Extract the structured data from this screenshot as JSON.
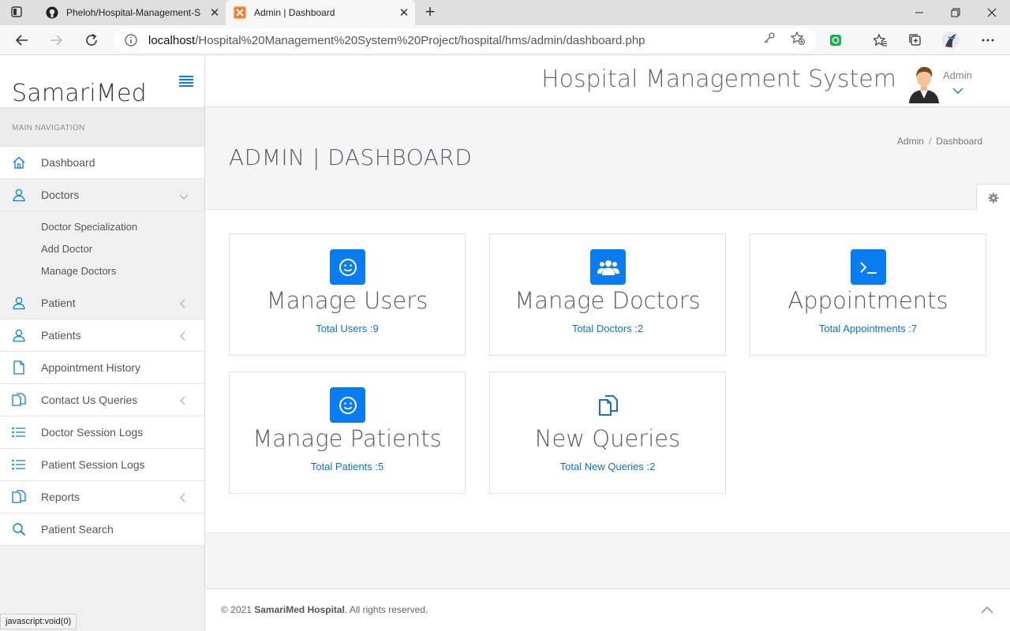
{
  "browser": {
    "tabs": [
      {
        "title": "Pheloh/Hospital-Management-S",
        "active": false,
        "favicon": "github-icon"
      },
      {
        "title": "Admin | Dashboard",
        "active": true,
        "favicon": "xampp-icon"
      }
    ],
    "url_host": "localhost",
    "url_path": "/Hospital%20Management%20System%20Project/hospital/hms/admin/dashboard.php",
    "status_text": "javascript:void(0)"
  },
  "sidebar": {
    "brand": "SamariMed",
    "nav_label": "MAIN NAVIGATION",
    "items": [
      {
        "label": "Dashboard",
        "icon": "home-icon"
      },
      {
        "label": "Doctors",
        "icon": "user-icon",
        "expanded": true,
        "sub": [
          "Doctor Specialization",
          "Add Doctor",
          "Manage Doctors"
        ]
      },
      {
        "label": "Patient",
        "icon": "user-icon"
      },
      {
        "label": "Patients",
        "icon": "user-icon"
      },
      {
        "label": "Appointment History",
        "icon": "file-icon"
      },
      {
        "label": "Contact Us Queries",
        "icon": "files-icon"
      },
      {
        "label": "Doctor Session Logs",
        "icon": "list-icon"
      },
      {
        "label": "Patient Session Logs",
        "icon": "list-icon"
      },
      {
        "label": "Reports",
        "icon": "files-icon"
      },
      {
        "label": "Patient Search",
        "icon": "search-icon"
      }
    ]
  },
  "header": {
    "title": "Hospital Management System",
    "user": "Admin"
  },
  "page": {
    "title": "ADMIN | DASHBOARD",
    "breadcrumb": [
      "Admin",
      "Dashboard"
    ],
    "breadcrumb_sep": "/"
  },
  "cards": [
    {
      "title": "Manage Users",
      "stat": "Total Users :9",
      "icon": "smile-icon"
    },
    {
      "title": "Manage Doctors",
      "stat": "Total Doctors :2",
      "icon": "users-icon"
    },
    {
      "title": "Appointments",
      "stat": "Total Appointments :7",
      "icon": "terminal-icon"
    },
    {
      "title": "Manage Patients",
      "stat": "Total Patients :5",
      "icon": "smile-icon"
    },
    {
      "title": "New Queries",
      "stat": "Total New Queries :2",
      "icon": "files-icon"
    }
  ],
  "footer": {
    "prefix": "© 2021 ",
    "brand": "SamariMed Hospital",
    "suffix": ". All rights reserved."
  },
  "colors": {
    "accent": "#0a7cf2",
    "link": "#0b73d8"
  }
}
